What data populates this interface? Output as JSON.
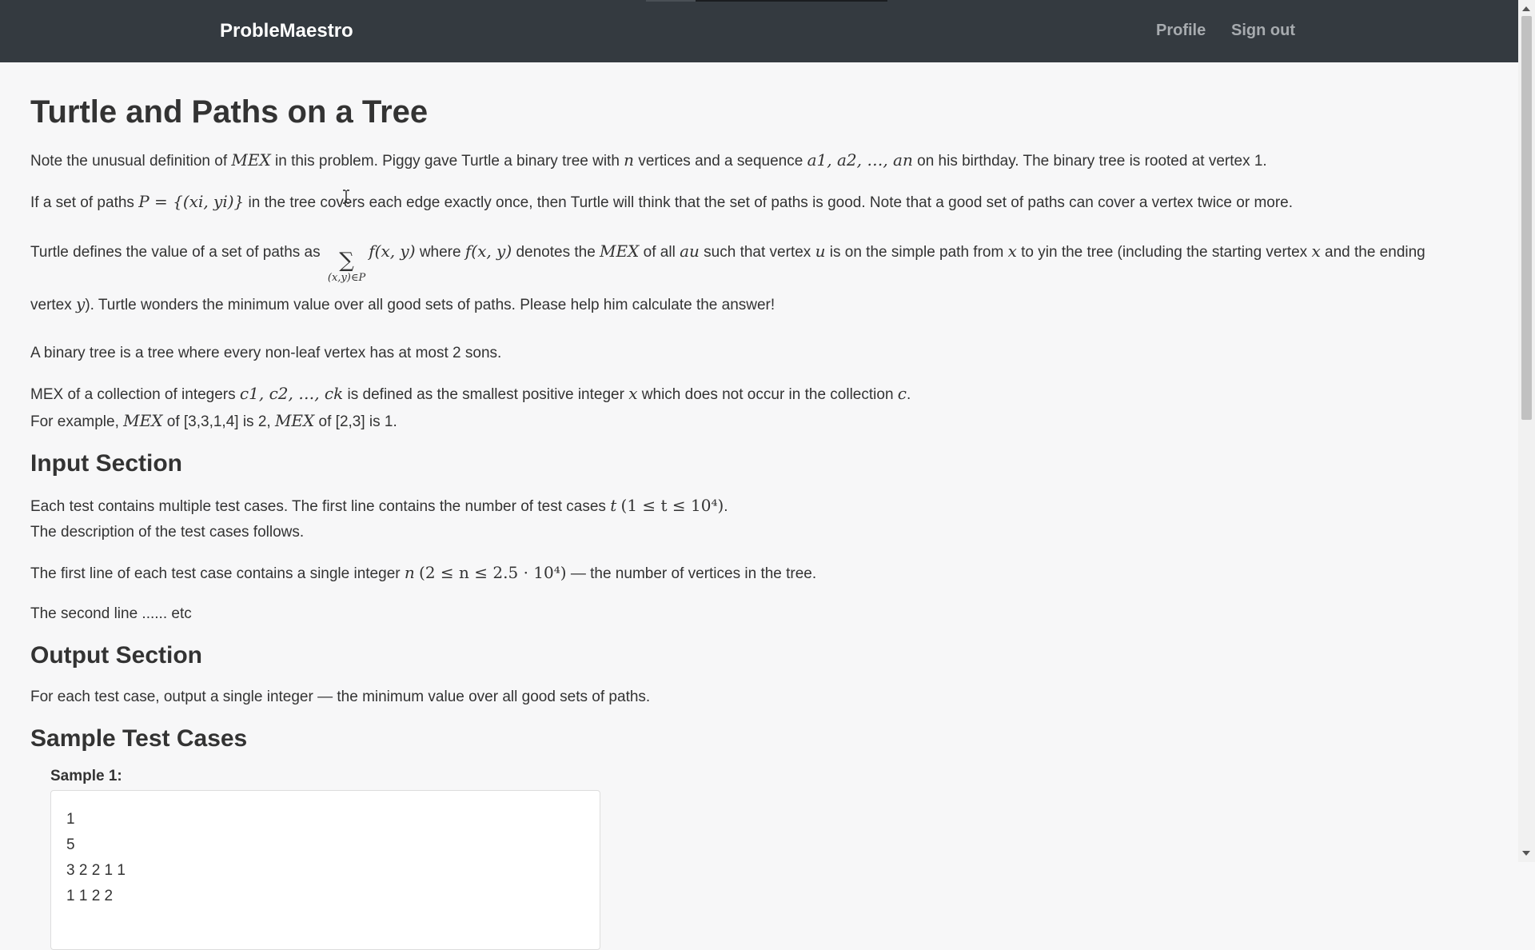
{
  "navbar": {
    "brand": "ProbleMaestro",
    "links": {
      "profile": "Profile",
      "sign_out": "Sign out"
    }
  },
  "problem": {
    "title": "Turtle and Paths on a Tree",
    "p1": {
      "a": "Note the unusual definition of ",
      "mex": "MEX",
      "b": " in this problem. Piggy gave Turtle a binary tree with ",
      "n": "n",
      "c": " vertices and a sequence ",
      "seq": "a1, a2, …, an",
      "d": " on his birthday. The binary tree is rooted at vertex 1."
    },
    "p2": {
      "a": "If a set of paths ",
      "set": "P = {(xi, yi)}",
      "b": " in the tree covers each edge exactly once, then Turtle will think that the set of paths is good. Note that a good set of paths can cover a vertex twice or more."
    },
    "p3": {
      "a": "Turtle defines the value of a set of paths as ",
      "sum_symbol": "∑",
      "sum_limit": "(x,y)∈P",
      "fxy": "f(x, y)",
      "b": " where ",
      "fxy2": "f(x, y)",
      "c": " denotes the ",
      "mex": "MEX",
      "d": " of all ",
      "au": "au",
      "e": " such that vertex ",
      "u": "u",
      "f": " is on the simple path from ",
      "x": "x",
      "g": " to yin the tree (including the starting vertex ",
      "x2": "x",
      "h": " and the ending vertex ",
      "y": "y",
      "i": "). Turtle wonders the minimum value over all good sets of paths. Please help him calculate the answer!"
    },
    "p4": "A binary tree is a tree where every non-leaf vertex has at most 2 sons.",
    "p5": {
      "a": "MEX of a collection of integers ",
      "seq": "c1, c2, …, ck",
      "b": " is defined as the smallest positive integer ",
      "x": "x",
      "c": " which does not occur in the collection ",
      "cc": "c",
      "d": ".",
      "e": "For example, ",
      "mex1": "MEX",
      "f": " of [3,3,1,4] is 2, ",
      "mex2": "MEX",
      "g": " of [2,3] is 1."
    }
  },
  "input_section": {
    "heading": "Input Section",
    "p1": {
      "a": "Each test contains multiple test cases. The first line contains the number of test cases ",
      "t": "t",
      "range": "(1 ≤ t ≤ 10⁴)",
      "b": ".",
      "c": "The description of the test cases follows."
    },
    "p2": {
      "a": "The first line of each test case contains a single integer ",
      "n": "n",
      "range": "(2 ≤ n ≤ 2.5 · 10⁴)",
      "b": " — the number of vertices in the tree."
    },
    "p3": "The second line ...... etc"
  },
  "output_section": {
    "heading": "Output Section",
    "p1": "For each test case, output a single integer — the minimum value over all good sets of paths."
  },
  "samples": {
    "heading": "Sample Test Cases",
    "sample1": {
      "label": "Sample 1:",
      "lines": [
        "1",
        "5",
        "3 2 2 1 1",
        "1 1 2 2"
      ]
    }
  }
}
